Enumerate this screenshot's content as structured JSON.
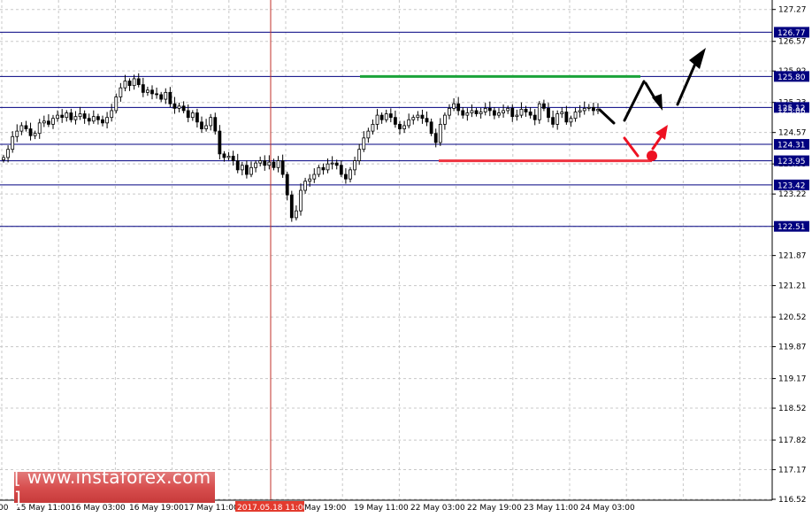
{
  "chart_data": {
    "type": "candlestick",
    "title": "",
    "ylim": [
      116.52,
      127.4
    ],
    "y_ticks": [
      127.27,
      126.57,
      125.92,
      125.23,
      124.57,
      123.88,
      123.22,
      122.51,
      121.87,
      121.21,
      120.52,
      119.87,
      119.17,
      118.52,
      117.82,
      117.17,
      116.52
    ],
    "x_ticks": [
      "00",
      "15 May 11:00",
      "16 May 03:00",
      "16 May 19:00",
      "17 May 11:00",
      "2017.05.18 11:00",
      "May 19:00",
      "19 May 11:00",
      "22 May 03:00",
      "22 May 19:00",
      "23 May 11:00",
      "24 May 03:00"
    ],
    "highlighted_time": "2017.05.18 11:00",
    "levels": [
      {
        "value": 126.77,
        "label": "126.77"
      },
      {
        "value": 125.8,
        "label": "125.80"
      },
      {
        "value": 125.12,
        "label": "125.12"
      },
      {
        "value": 124.31,
        "label": "124.31"
      },
      {
        "value": 123.95,
        "label": "123.95"
      },
      {
        "value": 123.42,
        "label": "123.42"
      },
      {
        "value": 122.51,
        "label": "122.51"
      }
    ],
    "current_price_label": "125.06",
    "close_series": [
      124.02,
      124.2,
      124.48,
      124.6,
      124.72,
      124.65,
      124.5,
      124.55,
      124.78,
      124.82,
      124.75,
      124.88,
      124.95,
      124.9,
      125.0,
      124.85,
      124.92,
      124.98,
      124.88,
      124.82,
      124.92,
      124.85,
      124.78,
      124.9,
      125.05,
      125.35,
      125.55,
      125.7,
      125.6,
      125.75,
      125.62,
      125.45,
      125.5,
      125.42,
      125.4,
      125.3,
      125.45,
      125.2,
      125.1,
      125.15,
      125.05,
      124.9,
      125.0,
      124.8,
      124.65,
      124.72,
      124.9,
      124.6,
      124.1,
      124.02,
      124.05,
      123.95,
      123.75,
      123.85,
      123.65,
      123.8,
      123.9,
      123.95,
      123.85,
      123.92,
      123.8,
      123.95,
      123.65,
      123.2,
      122.7,
      122.85,
      123.3,
      123.5,
      123.55,
      123.65,
      123.8,
      123.75,
      123.88,
      123.9,
      123.85,
      123.65,
      123.55,
      123.75,
      123.95,
      124.2,
      124.45,
      124.6,
      124.75,
      124.95,
      124.85,
      124.98,
      124.9,
      124.75,
      124.65,
      124.72,
      124.85,
      124.9,
      124.95,
      124.88,
      124.8,
      124.55,
      124.35,
      124.75,
      124.95,
      125.1,
      125.2,
      125.05,
      124.95,
      125.0,
      125.05,
      124.98,
      125.02,
      125.1,
      125.05,
      124.95,
      125.0,
      125.05,
      125.1,
      124.92,
      124.95,
      125.08,
      125.02,
      124.95,
      124.85,
      125.2,
      125.1,
      124.9,
      124.75,
      124.98,
      125.02,
      124.8,
      124.88,
      125.02,
      125.05,
      125.1,
      125.12,
      125.05,
      125.08
    ],
    "support_line": {
      "value": 123.95,
      "color": "#ee3340"
    },
    "resistance_line": {
      "value": 125.8,
      "color": "#1aa33a"
    },
    "forecast_color_up": "#000000",
    "forecast_color_down": "#ee1122"
  },
  "watermark": {
    "text": "[ www.instaforex.com ]"
  }
}
